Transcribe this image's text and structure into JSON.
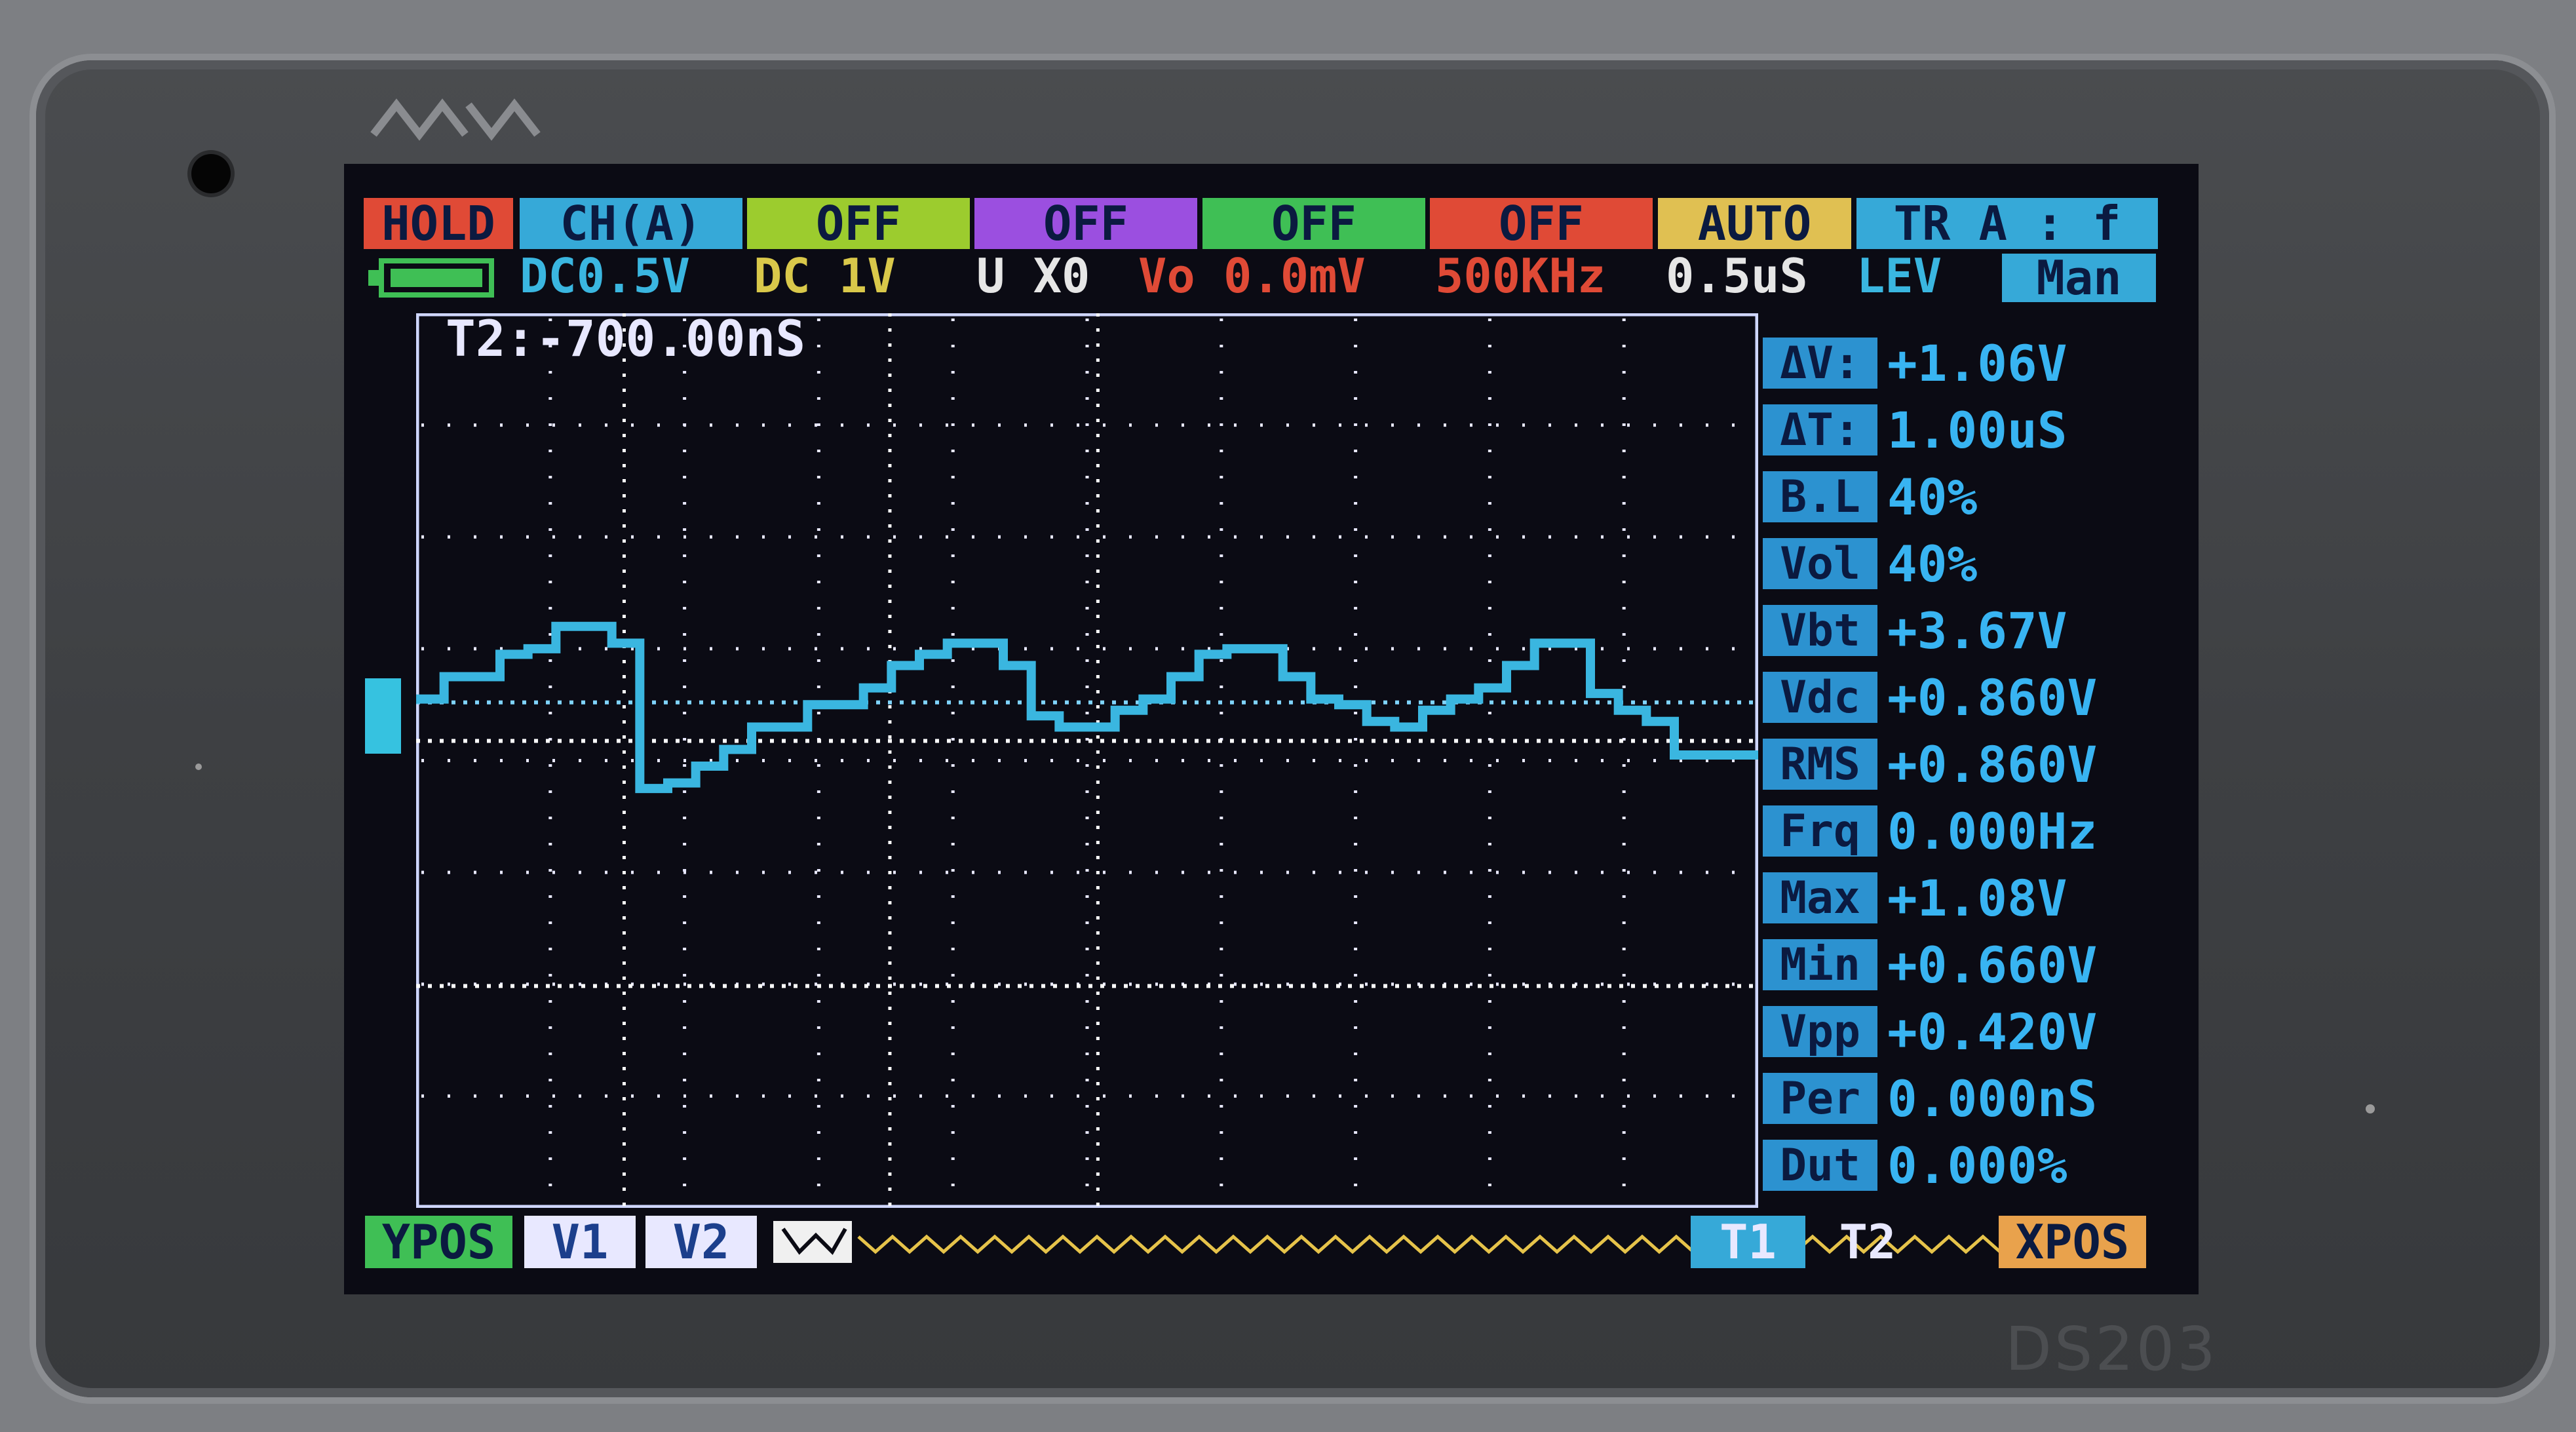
{
  "device": {
    "model": "DS203"
  },
  "top_bar": {
    "tabs": [
      {
        "label": "HOLD",
        "color": "#e04a36",
        "text_color": "#0b1a40"
      },
      {
        "label": "CH(A)",
        "color": "#36a9d8",
        "text_color": "#0b1a40"
      },
      {
        "label": "OFF",
        "color": "#9ccc2e",
        "text_color": "#0b1a40"
      },
      {
        "label": "OFF",
        "color": "#9b4fe0",
        "text_color": "#0b1a40"
      },
      {
        "label": "OFF",
        "color": "#3fbf55",
        "text_color": "#0b1a40"
      },
      {
        "label": "OFF",
        "color": "#e04a36",
        "text_color": "#0b1a40"
      },
      {
        "label": "AUTO",
        "color": "#e0c052",
        "text_color": "#0b1a40"
      },
      {
        "label": "TR A : f",
        "color": "#36a9d8",
        "text_color": "#0b1a40"
      }
    ]
  },
  "status_row": {
    "ch_a": "DC0.5V",
    "ch_b": "DC  1V",
    "ch_c": "U  X0",
    "ch_d": "Vo  0.0mV",
    "sample_rate": "500KHz",
    "timebase": "0.5uS",
    "trigger_level": "LEV",
    "trigger_mode": "Man",
    "battery_icon": "battery-icon"
  },
  "cursor_readout": {
    "text": "T2:-700.00nS"
  },
  "measurements": [
    {
      "key": "ΔV:",
      "value": "+1.06V"
    },
    {
      "key": "ΔT:",
      "value": " 1.00uS"
    },
    {
      "key": "B.L",
      "value": " 40%"
    },
    {
      "key": "Vol",
      "value": " 40%"
    },
    {
      "key": "Vbt",
      "value": "+3.67V"
    },
    {
      "key": "Vdc",
      "value": "+0.860V"
    },
    {
      "key": "RMS",
      "value": "+0.860V"
    },
    {
      "key": "Frq",
      "value": "0.000Hz"
    },
    {
      "key": "Max",
      "value": "+1.08V"
    },
    {
      "key": "Min",
      "value": "+0.660V"
    },
    {
      "key": "Vpp",
      "value": "+0.420V"
    },
    {
      "key": "Per",
      "value": "0.000nS"
    },
    {
      "key": "Dut",
      "value": "0.000%"
    }
  ],
  "bottom_bar": {
    "ypos": "YPOS",
    "v1": "V1",
    "v2": "V2",
    "t1": "T1",
    "t2": "T2",
    "xpos": "XPOS"
  },
  "colors": {
    "trace": "#3ab6e0",
    "grid": "#e8e8ff",
    "measure_value": "#38b4f2",
    "status_a": "#3ab6e0",
    "status_b": "#d9c84a",
    "status_c": "#e6e6e6",
    "status_d": "#e04a36",
    "status_rate": "#e04a36",
    "status_time": "#e6e6e6"
  },
  "chart_data": {
    "type": "line",
    "title": "",
    "xlabel": "",
    "ylabel": "",
    "x_divisions": 10,
    "y_divisions": 8,
    "series": [
      {
        "values_div": [
          4.55,
          4.75,
          4.75,
          4.95,
          5.0,
          5.2,
          5.2,
          5.05,
          3.75,
          3.8,
          3.95,
          4.1,
          4.3,
          4.3,
          4.5,
          4.5,
          4.65,
          4.85,
          4.95,
          5.05,
          5.05,
          4.85,
          4.4,
          4.3,
          4.3,
          4.45,
          4.55,
          4.75,
          4.95,
          5.0,
          5.0,
          4.75,
          4.55,
          4.5,
          4.35,
          4.3,
          4.45,
          4.55,
          4.65,
          4.85,
          5.05,
          5.05,
          4.6,
          4.45,
          4.35,
          4.05,
          4.05,
          4.05
        ]
      }
    ]
  }
}
